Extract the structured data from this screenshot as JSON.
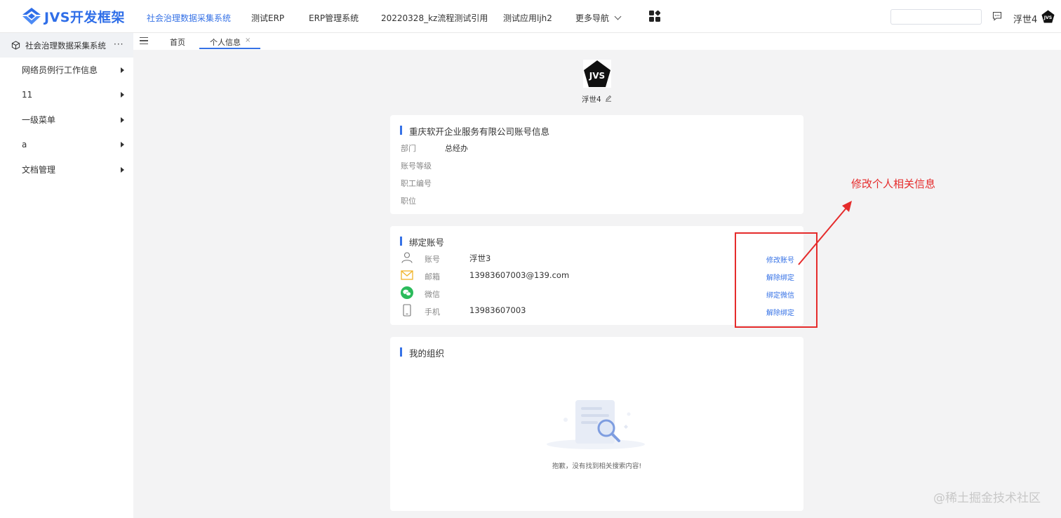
{
  "brand": {
    "name": "JVS开发框架"
  },
  "top_nav": {
    "items": [
      "社会治理数据采集系统",
      "测试ERP",
      "ERP管理系统",
      "20220328_kz流程测试引用",
      "测试应用ljh2",
      "更多导航"
    ],
    "username": "浮世4",
    "avatar_text": "JVS"
  },
  "sidebar": {
    "system_title": "社会治理数据采集系统",
    "more": "···",
    "items": [
      "网络员例行工作信息",
      "11",
      "一级菜单",
      "a",
      "文档管理"
    ]
  },
  "tabs": [
    "首页",
    "个人信息"
  ],
  "tab_close": "×",
  "profile": {
    "avatar_text": "JVS",
    "name": "浮世4"
  },
  "account_card": {
    "title": "重庆软开企业服务有限公司账号信息",
    "rows": [
      {
        "label": "部门",
        "value": "总经办"
      },
      {
        "label": "账号等级",
        "value": ""
      },
      {
        "label": "职工编号",
        "value": ""
      },
      {
        "label": "职位",
        "value": ""
      }
    ]
  },
  "bind_card": {
    "title": "绑定账号",
    "rows": [
      {
        "icon": "user-icon",
        "label": "账号",
        "value": "浮世3",
        "action": "修改账号"
      },
      {
        "icon": "mail-icon",
        "label": "邮箱",
        "value": "13983607003@139.com",
        "action": "解除绑定"
      },
      {
        "icon": "wechat-icon",
        "label": "微信",
        "value": "",
        "action": "绑定微信"
      },
      {
        "icon": "phone-icon",
        "label": "手机",
        "value": "13983607003",
        "action": "解除绑定"
      }
    ]
  },
  "org_card": {
    "title": "我的组织",
    "empty_text": "抱歉，没有找到相关搜索内容!"
  },
  "annotation": {
    "text": "修改个人相关信息",
    "color": "#e52b2b"
  },
  "watermark": "@稀土掘金技术社区",
  "colors": {
    "accent": "#3672e6",
    "annotation": "#e52b2b"
  }
}
